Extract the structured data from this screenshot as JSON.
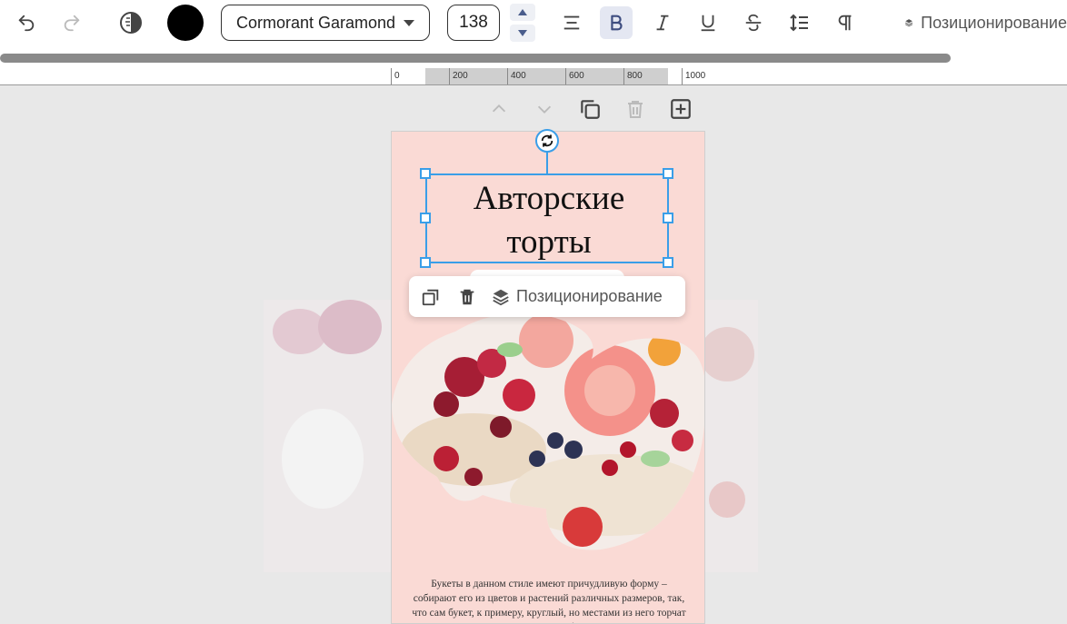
{
  "toolbar": {
    "font_family_value": "Cormorant Garamond",
    "font_size_value": "138",
    "text_color": "#000000",
    "positioning_label": "Позиционирование"
  },
  "ruler": {
    "ticks": [
      "0",
      "200",
      "400",
      "600",
      "800",
      "1000"
    ]
  },
  "canvas": {
    "title_line1": "Авторские",
    "title_line2": "торты",
    "body_text": "Букеты в данном стиле имеют причудливую форму – собирают его из цветов и растений различных размеров, так, что сам букет, к примеру, круглый, но местами из него торчат длинные стебли",
    "background_color": "#fadad5"
  },
  "context_menu": {
    "positioning_label": "Позиционирование"
  },
  "colors": {
    "selection": "#3a9ee8",
    "active_button_bg": "#e4e7f2"
  }
}
